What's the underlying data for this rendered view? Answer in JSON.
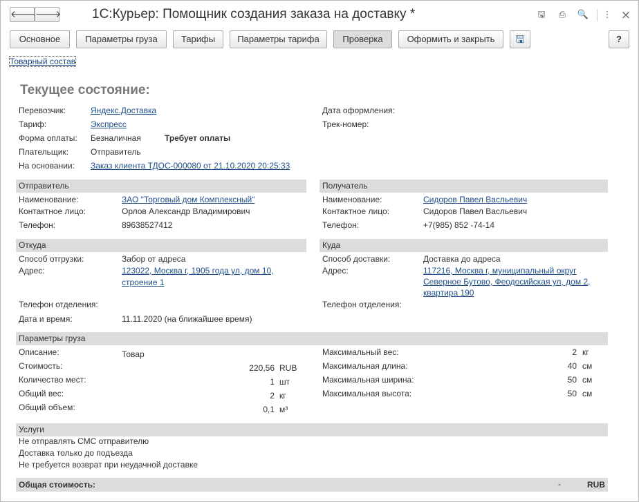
{
  "window": {
    "title": "1С:Курьер: Помощник создания заказа на доставку *",
    "back_glyph": "🡐",
    "forward_glyph": "🡒"
  },
  "title_icons": {
    "save": "🖫",
    "print": "⎙",
    "preview": "🔍",
    "more": "⋮",
    "close": "×"
  },
  "toolbar": {
    "main": "Основное",
    "cargo_params": "Параметры груза",
    "tariffs": "Тарифы",
    "tariff_params": "Параметры тарифа",
    "check": "Проверка",
    "issue_close": "Оформить и закрыть",
    "save_icon": "🖫",
    "help": "?"
  },
  "goods_link": "Товарный состав",
  "current_state": {
    "heading": "Текущее состояние:",
    "carrier_label": "Перевозчик:",
    "carrier_value": "Яндекс.Доставка",
    "tariff_label": "Тариф:",
    "tariff_value": "Экспресс",
    "payment_form_label": "Форма оплаты:",
    "payment_form_value": "Безналичная",
    "payment_status": "Требует оплаты",
    "payer_label": "Плательщик:",
    "payer_value": "Отправитель",
    "basis_label": "На основании:",
    "basis_value": "Заказ клиента ТДОС-000080 от 21.10.2020 20:25:33",
    "issue_date_label": "Дата оформления:",
    "track_label": "Трек-номер:"
  },
  "sender": {
    "header": "Отправитель",
    "name_label": "Наименование:",
    "name_value": "ЗАО \"Торговый дом Комплексный\"",
    "contact_label": "Контактное лицо:",
    "contact_value": "Орлов Александр Владимирович",
    "phone_label": "Телефон:",
    "phone_value": "89638527412"
  },
  "recipient": {
    "header": "Получатель",
    "name_label": "Наименование:",
    "name_value": "Сидоров Павел Васльевич",
    "contact_label": "Контактное лицо:",
    "contact_value": "Сидоров Павел Васльевич",
    "phone_label": "Телефон:",
    "phone_value": "+7(985) 852 -74-14"
  },
  "from": {
    "header": "Откуда",
    "method_label": "Способ отгрузки:",
    "method_value": "Забор от адреса",
    "address_label": "Адрес:",
    "address_line1": "123022, Москва г, 1905 года ул, дом 10,",
    "address_line2": "строение 1",
    "office_phone_label": "Телефон отделения:",
    "datetime_label": "Дата и время:",
    "datetime_value": "11.11.2020 (на ближайшее время)"
  },
  "to": {
    "header": "Куда",
    "method_label": "Способ доставки:",
    "method_value": "Доставка до адреса",
    "address_label": "Адрес:",
    "address_line1": "117216, Москва г, муниципальный округ",
    "address_line2": "Северное Бутово, Феодосийская ул, дом 2,",
    "address_line3": "квартира 190",
    "office_phone_label": "Телефон отделения:"
  },
  "cargo": {
    "header": "Параметры груза",
    "description_label": "Описание:",
    "description_value": "Товар",
    "cost_label": "Стоимость:",
    "cost_value": "220,56",
    "cost_unit": "RUB",
    "places_label": "Количество мест:",
    "places_value": "1",
    "places_unit": "шт",
    "weight_label": "Общий вес:",
    "weight_value": "2",
    "weight_unit": "кг",
    "volume_label": "Общий объем:",
    "volume_value": "0,1",
    "volume_unit": "м³",
    "max_weight_label": "Максимальный вес:",
    "max_weight_value": "2",
    "max_weight_unit": "кг",
    "max_length_label": "Максимальная длина:",
    "max_length_value": "40",
    "max_length_unit": "см",
    "max_width_label": "Максимальная ширина:",
    "max_width_value": "50",
    "max_width_unit": "см",
    "max_height_label": "Максимальная высота:",
    "max_height_value": "50",
    "max_height_unit": "см"
  },
  "services": {
    "header": "Услуги",
    "items": [
      "Не отправлять СМС отправителю",
      "Доставка только до подъезда",
      "Не требуется возврат при неудачной доставке"
    ]
  },
  "total": {
    "label": "Общая стоимость:",
    "value": "-",
    "unit": "RUB"
  }
}
